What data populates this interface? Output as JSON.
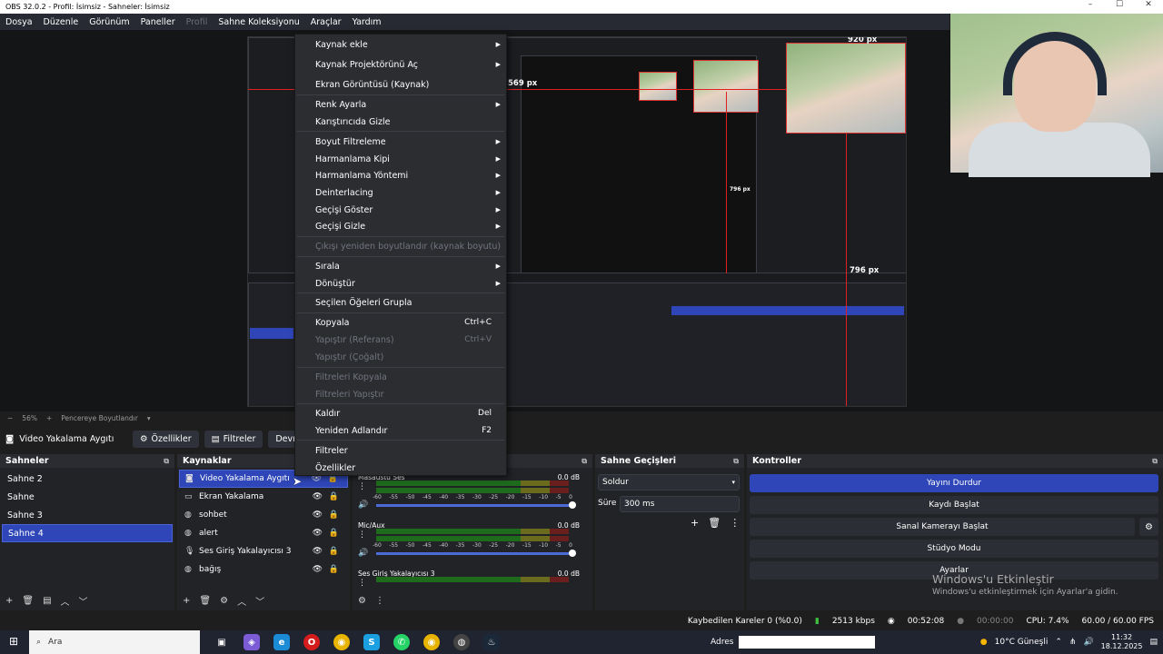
{
  "window": {
    "title": "OBS 32.0.2 - Profil: İsimsiz - Sahneler: İsimsiz"
  },
  "menubar": {
    "items": [
      "Dosya",
      "Düzenle",
      "Görünüm",
      "Paneller",
      "Profil",
      "Sahne Koleksiyonu",
      "Araçlar",
      "Yardım"
    ]
  },
  "preview": {
    "labels": {
      "top_px": "920 px",
      "left_px": "569 px",
      "mid_px": "796 px",
      "right_px": "796 px"
    },
    "zoom": "56%",
    "zoom_mode": "Pencereye Boyutlandır"
  },
  "source_toolbar": {
    "source_name": "Video Yakalama Aygıtı",
    "properties": "Özellikler",
    "filters": "Filtreler",
    "deactivate": "Devred"
  },
  "context_menu": {
    "items": [
      {
        "label": "Kaynak ekle",
        "sub": true
      },
      {
        "label": "Kaynak Projektörünü Aç",
        "sub": true
      },
      {
        "label": "Ekran Görüntüsü (Kaynak)"
      },
      {
        "label": "Renk Ayarla",
        "sub": true
      },
      {
        "label": "Karıştırıcıda Gizle"
      },
      {
        "label": "Boyut Filtreleme",
        "sub": true
      },
      {
        "label": "Harmanlama Kipi",
        "sub": true
      },
      {
        "label": "Harmanlama Yöntemi",
        "sub": true
      },
      {
        "label": "Deinterlacing",
        "sub": true
      },
      {
        "label": "Geçişi Göster",
        "sub": true
      },
      {
        "label": "Geçişi Gizle",
        "sub": true
      },
      {
        "label": "Çıkışı yeniden boyutlandır (kaynak boyutu)",
        "disabled": true
      },
      {
        "label": "Sırala",
        "sub": true
      },
      {
        "label": "Dönüştür",
        "sub": true
      },
      {
        "label": "Seçilen Öğeleri Grupla"
      },
      {
        "label": "Kopyala",
        "shortcut": "Ctrl+C"
      },
      {
        "label": "Yapıştır (Referans)",
        "shortcut": "Ctrl+V",
        "disabled": true
      },
      {
        "label": "Yapıştır (Çoğalt)",
        "disabled": true
      },
      {
        "label": "Filtreleri Kopyala",
        "disabled": true
      },
      {
        "label": "Filtreleri Yapıştır",
        "disabled": true
      },
      {
        "label": "Kaldır",
        "shortcut": "Del"
      },
      {
        "label": "Yeniden Adlandır",
        "shortcut": "F2"
      },
      {
        "label": "Filtreler"
      },
      {
        "label": "Özellikler"
      }
    ]
  },
  "scenes": {
    "title": "Sahneler",
    "items": [
      "Sahne 2",
      "Sahne",
      "Sahne 3",
      "Sahne 4"
    ],
    "selected": 3
  },
  "sources": {
    "title": "Kaynaklar",
    "items": [
      {
        "name": "Video Yakalama Aygıtı",
        "icon": "camera-icon"
      },
      {
        "name": "Ekran Yakalama",
        "icon": "monitor-icon"
      },
      {
        "name": "sohbet",
        "icon": "globe-icon"
      },
      {
        "name": "alert",
        "icon": "globe-icon"
      },
      {
        "name": "Ses Giriş Yakalayıcısı 3",
        "icon": "microphone-icon"
      },
      {
        "name": "bağış",
        "icon": "globe-icon"
      }
    ],
    "selected": 0
  },
  "mixer": {
    "channels": [
      {
        "name": "Masaüstü Ses",
        "db": "0.0 dB"
      },
      {
        "name": "Mic/Aux",
        "db": "0.0 dB"
      },
      {
        "name": "Ses Giriş Yakalayıcısı 3",
        "db": "0.0 dB"
      }
    ],
    "scale": [
      "-60",
      "-55",
      "-50",
      "-45",
      "-40",
      "-35",
      "-30",
      "-25",
      "-20",
      "-15",
      "-10",
      "-5",
      "0"
    ]
  },
  "transitions": {
    "title": "Sahne Geçişleri",
    "selected": "Soldur",
    "duration_label": "Süre",
    "duration": "300 ms"
  },
  "controls": {
    "title": "Kontroller",
    "buttons": [
      "Yayını Durdur",
      "Kaydı Başlat",
      "Sanal Kamerayı Başlat",
      "Stüdyo Modu",
      "Ayarlar"
    ]
  },
  "watermark": {
    "line1": "Windows'u Etkinleştir",
    "line2": "Windows'u etkinleştirmek için Ayarlar'a gidin."
  },
  "statusbar": {
    "dropped": "Kaybedilen Kareler 0 (%0.0)",
    "bitrate": "2513 kbps",
    "stream_time": "00:52:08",
    "rec_time": "00:00:00",
    "cpu": "CPU: 7.4%",
    "fps": "60.00 / 60.00 FPS"
  },
  "taskbar": {
    "search_placeholder": "Ara",
    "address_label": "Adres",
    "weather": "10°C Güneşli",
    "time": "11:32",
    "date": "18.12.2025"
  },
  "colors": {
    "accent": "#2e46b8",
    "panel": "#222327",
    "bg": "#1f1e1f"
  }
}
